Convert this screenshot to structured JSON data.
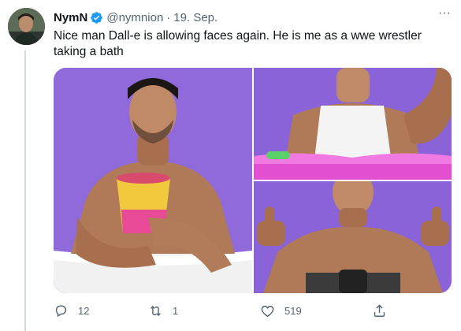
{
  "tweet": {
    "author_name": "NymN",
    "handle": "@nymnion",
    "separator": "·",
    "date": "19. Sep.",
    "text": "Nice man Dall-e is allowing faces again. He is me as a wwe wrestler taking a bath",
    "more_label": "···"
  },
  "media": {
    "count": 3,
    "background_color": "#8a63d8"
  },
  "actions": {
    "reply_count": "12",
    "retweet_count": "1",
    "like_count": "519",
    "icons": [
      "reply-icon",
      "retweet-icon",
      "like-icon",
      "share-icon"
    ]
  },
  "colors": {
    "text_primary": "#0f1419",
    "text_secondary": "#536471",
    "verified_blue": "#1d9bf0"
  }
}
